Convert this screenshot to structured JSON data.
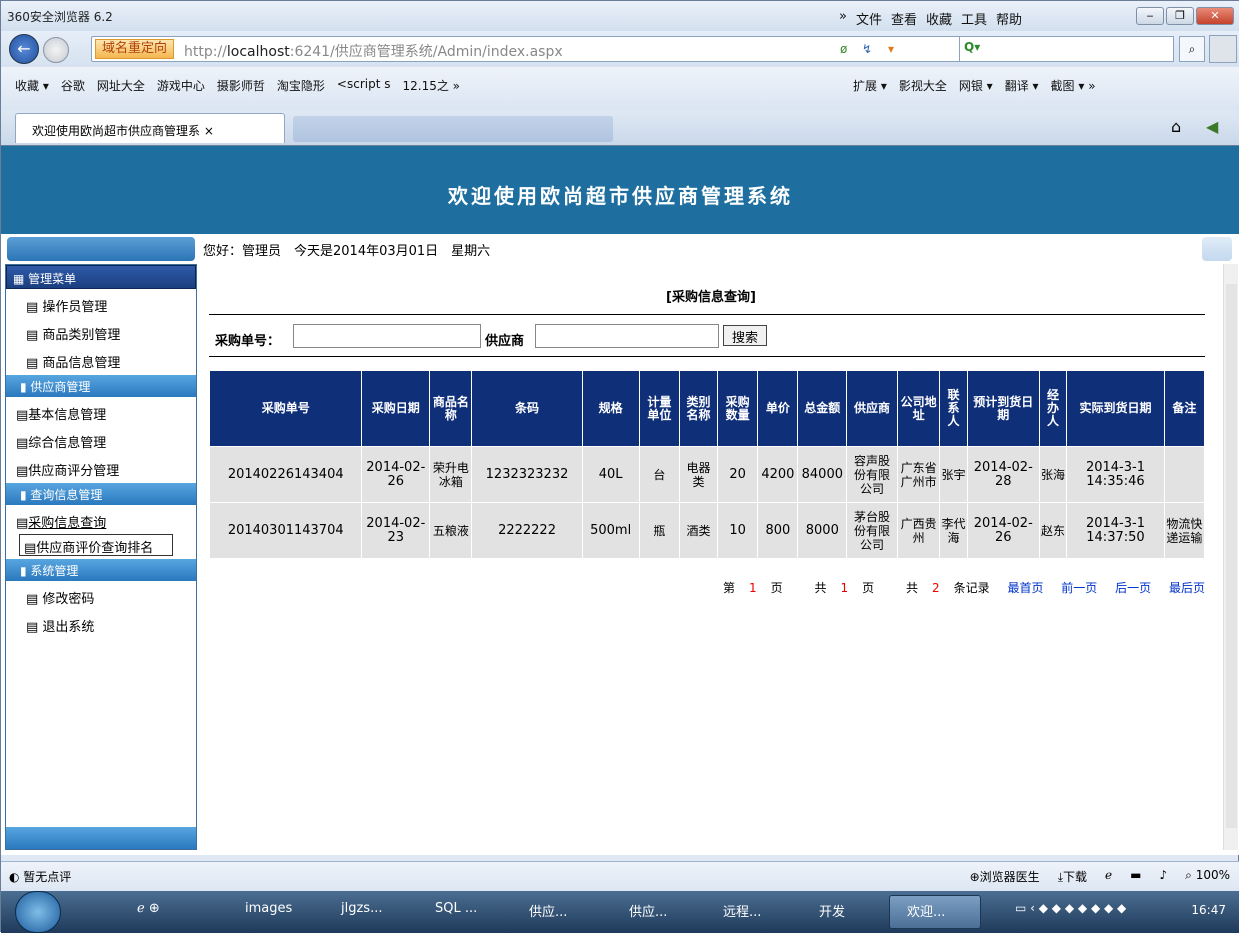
{
  "browser": {
    "title": "360安全浏览器 6.2",
    "menus": [
      "»",
      "文件",
      "查看",
      "收藏",
      "工具",
      "帮助"
    ],
    "redirect_label": "域名重定向",
    "url_prefix": "http://",
    "url_host": "localhost",
    "url_rest": ":6241/供应商管理系统/Admin/index.aspx",
    "favorites": [
      "收藏 ▾",
      "谷歌",
      "网址大全",
      "游戏中心",
      "摄影师哲",
      "淘宝隐形",
      "<script s",
      "12.15之 »"
    ],
    "favorites_right": [
      "扩展 ▾",
      "影视大全",
      "网银 ▾",
      "翻译 ▾",
      "截图 ▾ »"
    ],
    "tab_title": "欢迎使用欧尚超市供应商管理系 ×"
  },
  "page": {
    "header_title": "欢迎使用欧尚超市供应商管理系统",
    "greeting": "您好：管理员　今天是2014年03月01日　星期六"
  },
  "sidebar": {
    "menu_title": "管理菜单",
    "items_top": [
      "操作员管理",
      "商品类别管理",
      "商品信息管理"
    ],
    "group_supplier": "供应商管理",
    "items_supplier": [
      "基本信息管理",
      "综合信息管理",
      "供应商评分管理"
    ],
    "group_query": "查询信息管理",
    "items_query": [
      "采购信息查询",
      "供应商评价查询排名"
    ],
    "group_system": "系统管理",
    "items_system": [
      "修改密码",
      "退出系统"
    ]
  },
  "content": {
    "title": "[采购信息查询]",
    "search": {
      "order_label": "采购单号：",
      "order_value": "",
      "supplier_label": "供应商",
      "supplier_value": "",
      "button": "搜索"
    },
    "columns": [
      "采购单号",
      "采购日期",
      "商品名称",
      "条码",
      "规格",
      "计量单位",
      "类别名称",
      "采购数量",
      "单价",
      "总金额",
      "供应商",
      "公司地址",
      "联系人",
      "预计到货日期",
      "经办人",
      "实际到货日期",
      "备注"
    ],
    "rows": [
      [
        "20140226143404",
        "2014-02-26",
        "荣升电冰箱",
        "1232323232",
        "40L",
        "台",
        "电器类",
        "20",
        "4200",
        "84000",
        "容声股份有限公司",
        "广东省广州市",
        "张宇",
        "2014-02-28",
        "张海",
        "2014-3-1 14:35:46",
        ""
      ],
      [
        "20140301143704",
        "2014-02-23",
        "五粮液",
        "2222222",
        "500ml",
        "瓶",
        "酒类",
        "10",
        "800",
        "8000",
        "茅台股份有限公司",
        "广西贵州",
        "李代海",
        "2014-02-26",
        "赵东",
        "2014-3-1 14:37:50",
        "物流快递运输"
      ]
    ],
    "pager": {
      "page_pre": "第",
      "page_num": "1",
      "page_post": "页",
      "total_pre": "共",
      "total_num": "1",
      "total_post": "页",
      "rec_pre": "共",
      "rec_num": "2",
      "rec_post": "条记录",
      "first": "最首页",
      "prev": "前一页",
      "next": "后一页",
      "last": "最后页"
    }
  },
  "statusbar": {
    "left": "暂无点评",
    "right": [
      "浏览器医生",
      "下载",
      "",
      "",
      "",
      "100%"
    ]
  },
  "taskbar": {
    "items": [
      "images",
      "jlgzs...",
      "SQL ...",
      "供应...",
      "供应...",
      "远程...",
      "开发",
      "欢迎..."
    ],
    "clock": "16:47"
  }
}
